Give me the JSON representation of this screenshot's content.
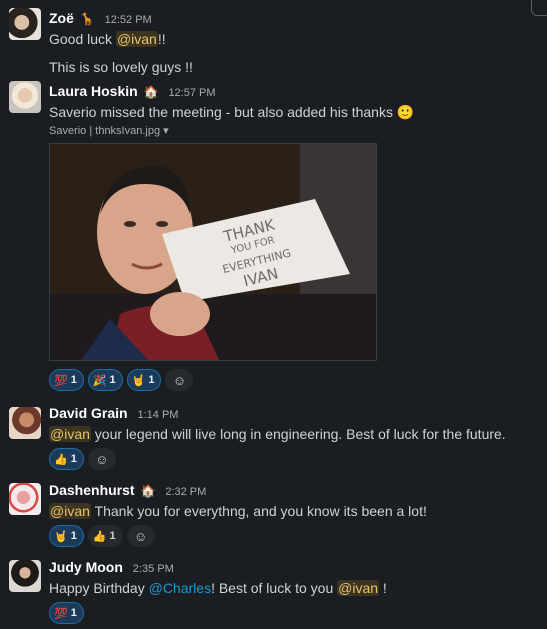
{
  "messages": [
    {
      "name": "Zoë",
      "status_emoji": "🦒",
      "time": "12:52 PM",
      "line1_pre": "Good luck ",
      "mention": "@ivan",
      "line1_post": "!!",
      "line2": "This is so lovely guys !!"
    },
    {
      "name": "Laura Hoskin",
      "status_emoji": "🏠",
      "time": "12:57 PM",
      "text": "Saverio missed the meeting - but also added his thanks",
      "emoji": "🙂",
      "file_label": "Saverio | thnksIvan.jpg",
      "file_caret": "▾",
      "sign_text": [
        "THANK",
        "YOU FOR",
        "EVERYTHING",
        "IVAN"
      ],
      "reactions": [
        {
          "emoji": "💯",
          "count": "1"
        },
        {
          "emoji": "🎉",
          "count": "1"
        },
        {
          "emoji": "🤘",
          "count": "1"
        }
      ]
    },
    {
      "name": "David Grain",
      "time": "1:14 PM",
      "mention": "@ivan",
      "text": " your legend will live long in engineering. Best of luck for the future.",
      "reactions": [
        {
          "emoji": "👍",
          "count": "1"
        }
      ]
    },
    {
      "name": "Dashenhurst",
      "status_emoji": "🏠",
      "time": "2:32 PM",
      "mention": "@ivan",
      "text": " Thank you for everythng, and you know its been a lot!",
      "reactions": [
        {
          "emoji": "🤘",
          "count": "1"
        },
        {
          "emoji": "👍",
          "count": "1"
        }
      ]
    },
    {
      "name": "Judy Moon",
      "time": "2:35 PM",
      "text_pre": "Happy Birthday ",
      "link": "@Charles",
      "text_mid": "! Best of luck to you ",
      "mention": "@ivan",
      "text_post": " !",
      "reactions": [
        {
          "emoji": "💯",
          "count": "1"
        }
      ]
    }
  ],
  "add_reaction_icon": "add-reaction-icon"
}
